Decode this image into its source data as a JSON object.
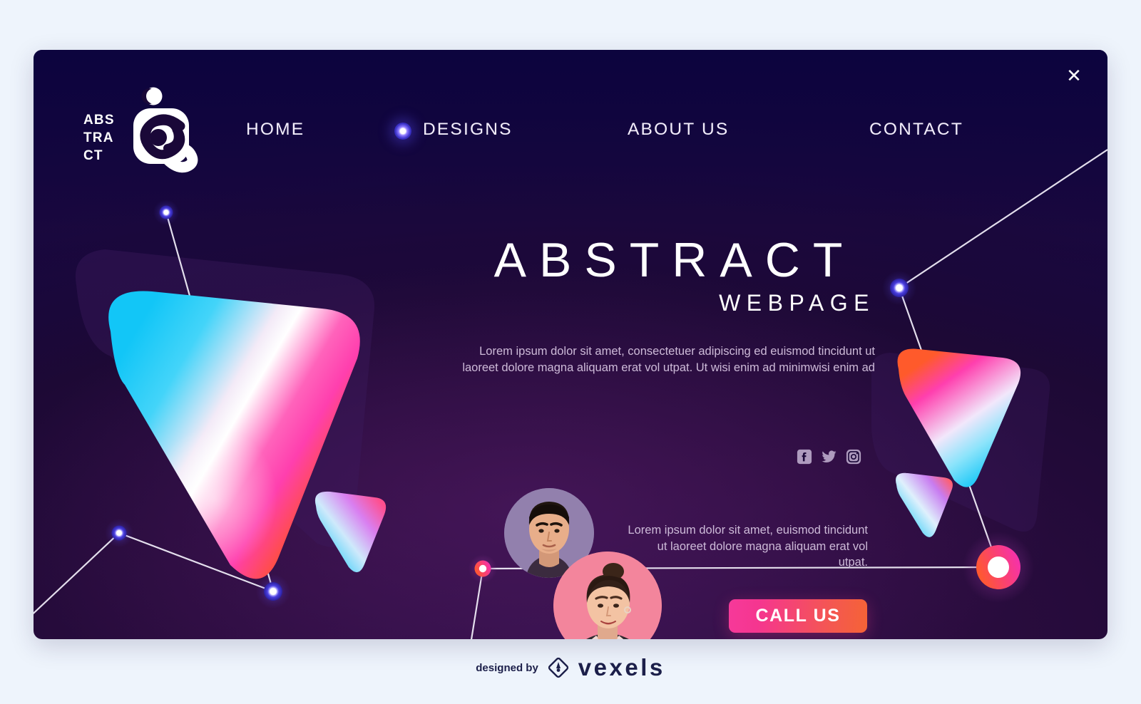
{
  "window": {
    "close_label": "✕",
    "background_color": "#eef4fc",
    "card_color": "#1a0838"
  },
  "brand": {
    "logo_line1": "ABS",
    "logo_line2": "TRA",
    "logo_line3": "CT",
    "logo_icon": "abstract-spiral-logo"
  },
  "nav": {
    "items": [
      {
        "label": "HOME",
        "active": false
      },
      {
        "label": "DESIGNS",
        "active": true
      },
      {
        "label": "ABOUT US",
        "active": false
      },
      {
        "label": "CONTACT",
        "active": false
      }
    ],
    "active_indicator_color": "#5b4df0"
  },
  "hero": {
    "title": "ABSTRACT",
    "subtitle": "WEBPAGE",
    "paragraph": "Lorem ipsum dolor sit amet, consectetuer adipiscing ed euismod tincidunt ut laoreet dolore magna aliquam erat vol utpat. Ut wisi enim ad minimwisi enim ad"
  },
  "social": {
    "items": [
      {
        "name": "facebook-icon",
        "label": "Facebook"
      },
      {
        "name": "twitter-icon",
        "label": "Twitter"
      },
      {
        "name": "instagram-icon",
        "label": "Instagram"
      }
    ],
    "color": "#b9a7c9"
  },
  "secondary": {
    "paragraph": "Lorem ipsum dolor sit amet, euismod tincidunt ut laoreet dolore magna aliquam erat vol utpat."
  },
  "cta": {
    "label": "CALL US",
    "gradient_from": "#f6399a",
    "gradient_to": "#f56336"
  },
  "avatars": [
    {
      "name": "avatar-man",
      "backdrop_color": "#8d73aa"
    },
    {
      "name": "avatar-woman",
      "backdrop_color": "#f2849b"
    }
  ],
  "decor": {
    "triangle_large": {
      "from": "#18c8f5",
      "mid": "#ffffff",
      "to": "#ff5a2b"
    },
    "triangle_right": {
      "from": "#ff5a2b",
      "mid": "#ffffff",
      "to": "#18c8f5"
    },
    "node_color_blue": "#5b4df0",
    "node_color_pink": "#f6399a"
  },
  "footer": {
    "designed_by": "designed by",
    "brand": "vexels",
    "logo_icon": "vexels-diamond-pen-icon"
  }
}
